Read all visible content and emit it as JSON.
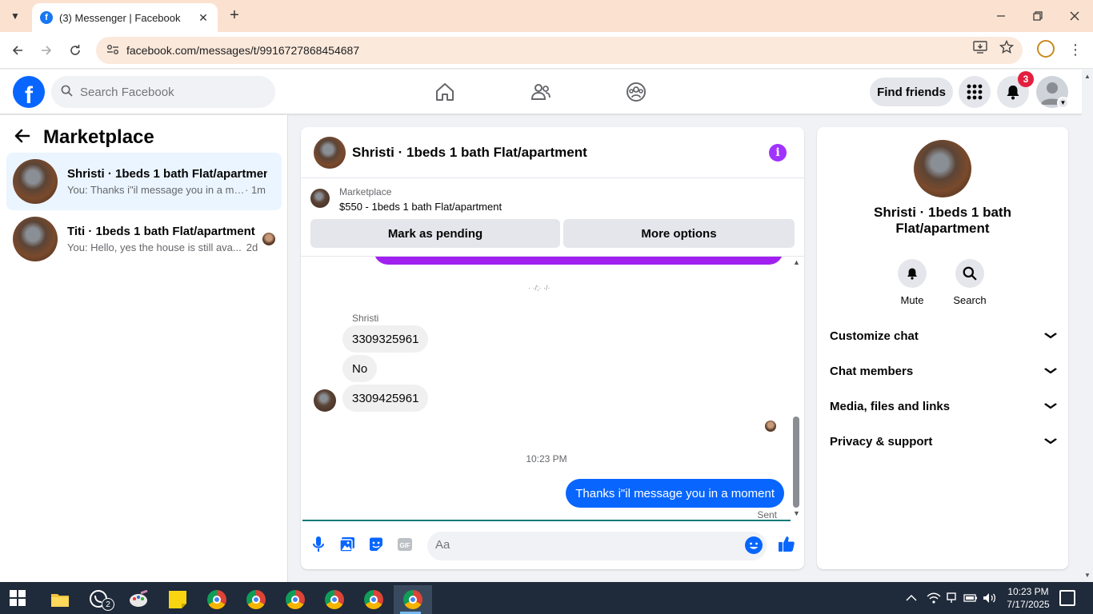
{
  "browser": {
    "tab_title": "(3) Messenger | Facebook",
    "favicon_letter": "f",
    "url": "facebook.com/messages/t/9916727868454687",
    "new_tab_symbol": "+",
    "close_tab_symbol": "✕"
  },
  "fb_header": {
    "logo_letter": "f",
    "search_placeholder": "Search Facebook",
    "find_friends_label": "Find friends",
    "notification_count": "3"
  },
  "left_panel": {
    "title": "Marketplace",
    "conversations": [
      {
        "name": "Shristi · 1beds 1 bath Flat/apartment",
        "preview": "You: Thanks i\"il message you in a mo...",
        "time": "· 1m",
        "active": true
      },
      {
        "name": "Titi · 1beds 1 bath Flat/apartment",
        "preview": "You: Hello, yes the house is still ava...",
        "time": "2d",
        "active": false
      }
    ]
  },
  "chat": {
    "header_name": "Shristi · 1beds 1 bath Flat/apartment",
    "info_symbol": "i",
    "marketplace_label": "Marketplace",
    "listing": "$550 - 1beds 1 bath Flat/apartment",
    "mark_pending_label": "Mark as pending",
    "more_options_label": "More options",
    "partial_text": "· ·/;· ·/·",
    "sender_name": "Shristi",
    "incoming_messages": [
      "3309325961",
      "No",
      "3309425961"
    ],
    "timestamp": "10:23 PM",
    "outgoing_message": "Thanks i\"il message you in a moment",
    "sent_label": "Sent",
    "composer_placeholder": "Aa",
    "gif_label": "GIF"
  },
  "right_panel": {
    "name": "Shristi · 1beds 1 bath Flat/apartment",
    "mute_label": "Mute",
    "search_label": "Search",
    "sections": [
      "Customize chat",
      "Chat members",
      "Media, files and links",
      "Privacy & support"
    ]
  },
  "taskbar": {
    "whatsapp_badge": "2",
    "time": "10:23 PM",
    "date": "7/17/2025"
  },
  "colors": {
    "fb_blue": "#0866ff",
    "purple_accent": "#a033ff",
    "notif_red": "#e41e3f",
    "active_convo_bg": "#ebf5ff"
  }
}
